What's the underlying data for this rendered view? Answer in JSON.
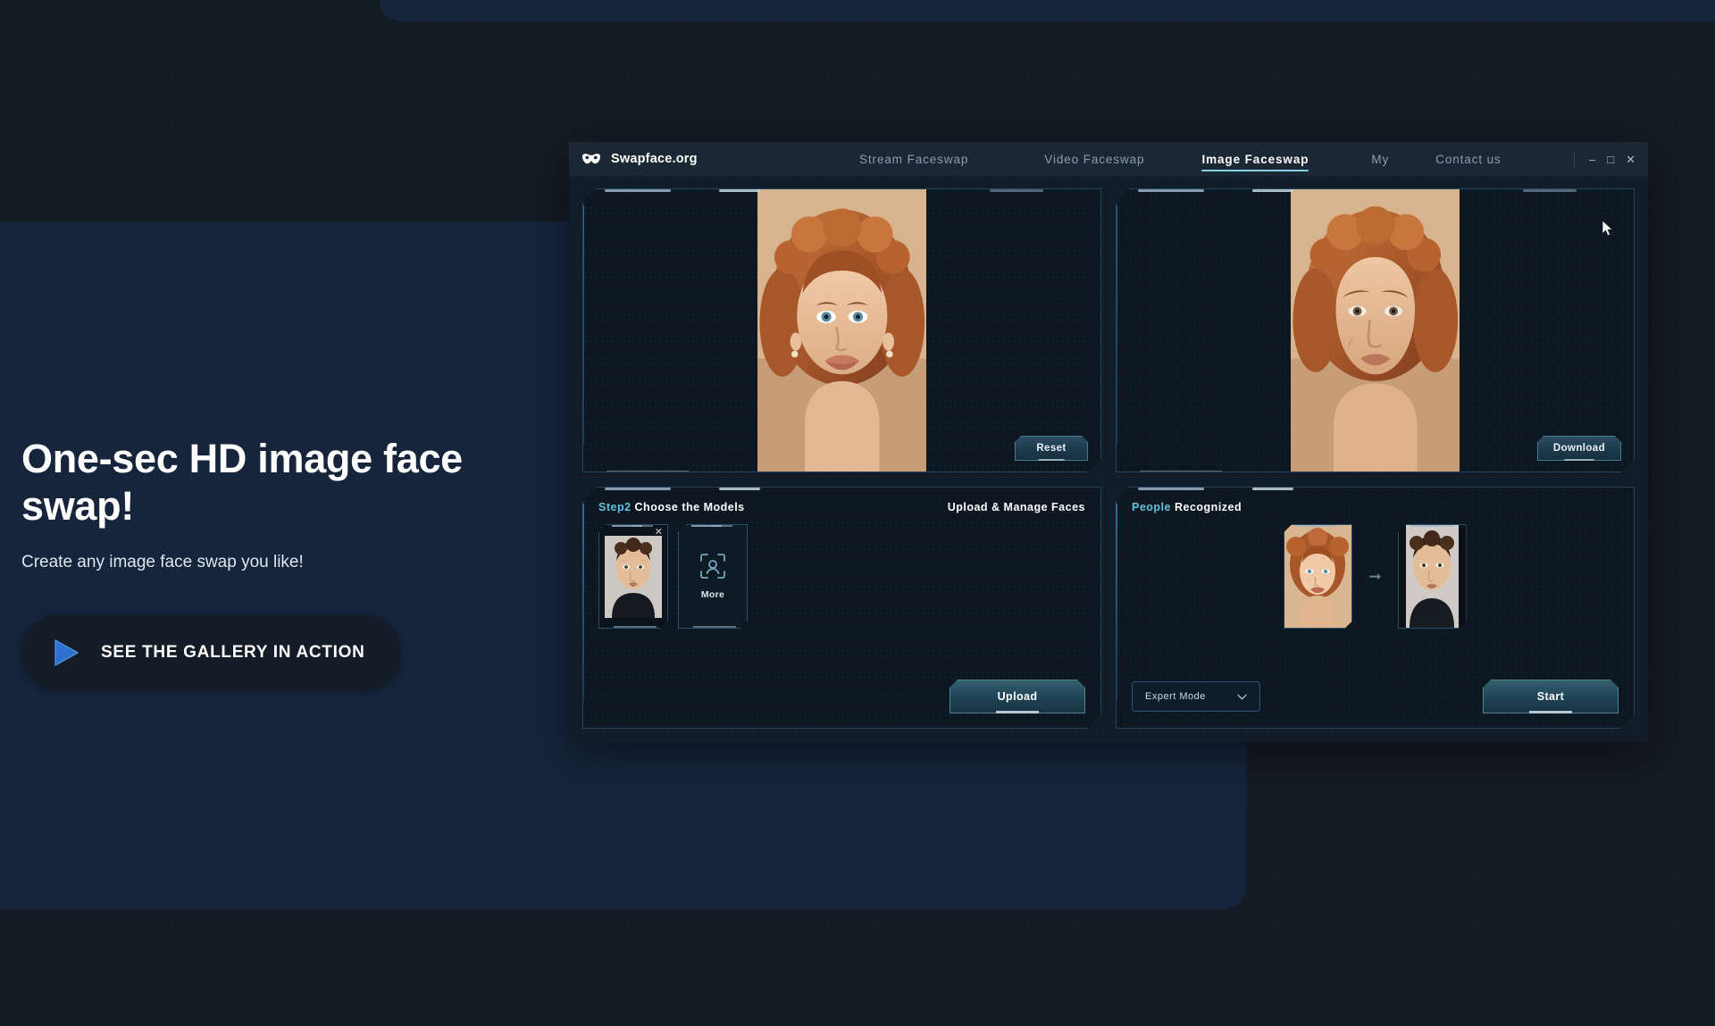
{
  "hero": {
    "title": "One-sec HD image face swap!",
    "subtitle": "Create any image face swap you like!",
    "cta_label": "SEE THE GALLERY IN ACTION",
    "play_icon": "play-icon"
  },
  "app": {
    "brand": "Swapface.org",
    "logo_icon": "mask-icon",
    "nav": [
      {
        "label": "Stream Faceswap",
        "active": false
      },
      {
        "label": "Video Faceswap",
        "active": false
      },
      {
        "label": "Image Faceswap",
        "active": true
      },
      {
        "label": "My",
        "active": false
      },
      {
        "label": "Contact us",
        "active": false
      }
    ],
    "window_controls": [
      {
        "glyph": "–",
        "name": "minimize"
      },
      {
        "glyph": "□",
        "name": "maximize"
      },
      {
        "glyph": "✕",
        "name": "close"
      }
    ],
    "source_preview": {
      "action_label": "Reset"
    },
    "result_preview": {
      "action_label": "Download"
    },
    "models_panel": {
      "step_label": "Step2",
      "title": "Choose the Models",
      "manage_label": "Upload & Manage Faces",
      "more_label": "More",
      "more_icon": "face-scan-icon",
      "remove_icon": "close-icon",
      "upload_label": "Upload"
    },
    "recognized_panel": {
      "accent_label": "People",
      "title": "Recognized",
      "arrow_icon": "arrow-right-icon",
      "mode_value": "Expert Mode",
      "mode_icon": "chevron-down-icon",
      "start_label": "Start"
    }
  },
  "colors": {
    "accent_cyan": "#5fc3dd",
    "hero_panel": "#16243c",
    "page_bg": "#131b24",
    "cta_blue": "#2f6fd0"
  }
}
